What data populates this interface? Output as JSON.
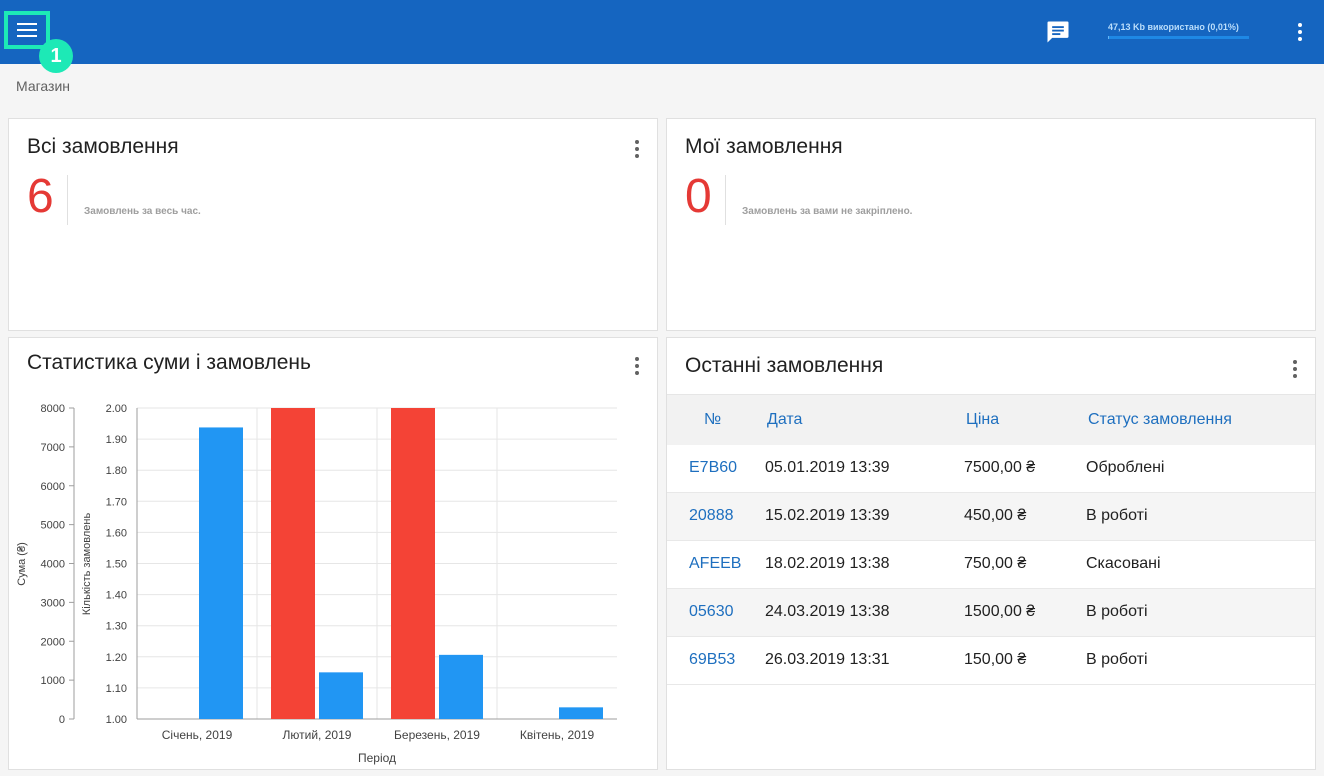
{
  "header": {
    "storage_text": "47,13 Kb використано (0,01%)",
    "storage_percent": 0.01,
    "step_badge": "1",
    "accent": "#1565c0",
    "icons": [
      "menu-icon",
      "chat-icon",
      "more-vert-icon"
    ]
  },
  "breadcrumb": "Магазин",
  "cards": {
    "all_orders": {
      "title": "Всі замовлення",
      "count": "6",
      "caption": "Замовлень за весь час."
    },
    "my_orders": {
      "title": "Мої замовлення",
      "count": "0",
      "caption": "Замовлень за вами не закріплено."
    },
    "stats": {
      "title": "Статистика суми і замовлень"
    },
    "recent": {
      "title": "Останні замовлення",
      "columns": [
        "№",
        "Дата",
        "Ціна",
        "Статус замовлення"
      ],
      "rows": [
        {
          "id": "E7B60",
          "date": "05.01.2019 13:39",
          "price": "7500,00 ₴",
          "status": "Оброблені"
        },
        {
          "id": "20888",
          "date": "15.02.2019 13:39",
          "price": "450,00 ₴",
          "status": "В роботі"
        },
        {
          "id": "AFEEB",
          "date": "18.02.2019 13:38",
          "price": "750,00 ₴",
          "status": "Скасовані"
        },
        {
          "id": "05630",
          "date": "24.03.2019 13:38",
          "price": "1500,00 ₴",
          "status": "В роботі"
        },
        {
          "id": "69B53",
          "date": "26.03.2019 13:31",
          "price": "150,00 ₴",
          "status": "В роботі"
        }
      ]
    }
  },
  "chart_data": {
    "type": "bar",
    "categories": [
      "Січень, 2019",
      "Лютий, 2019",
      "Березень, 2019",
      "Квітень, 2019"
    ],
    "series": [
      {
        "axis": "right",
        "color": "#f44336",
        "values": [
          0,
          2,
          2,
          0
        ]
      },
      {
        "axis": "left",
        "color": "#2196f3",
        "values": [
          7500,
          1200,
          1650,
          300
        ]
      }
    ],
    "xlabel": "Період",
    "ylabel_left": "Сума (₴)",
    "ylabel_right": "Кількість замовлень",
    "ylim_left": [
      0,
      8000
    ],
    "ylim_right": [
      1,
      2
    ],
    "yticks_left": [
      "0",
      "1000",
      "2000",
      "3000",
      "4000",
      "5000",
      "6000",
      "7000",
      "8000"
    ],
    "yticks_right": [
      "1.00",
      "1.10",
      "1.20",
      "1.30",
      "1.40",
      "1.50",
      "1.60",
      "1.70",
      "1.80",
      "1.90",
      "2.00"
    ],
    "grid": true
  }
}
